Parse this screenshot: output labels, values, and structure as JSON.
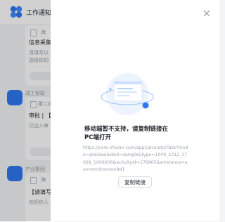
{
  "header": {
    "app_title": "工作通知:A"
  },
  "feed": {
    "card1": {
      "meta": "海",
      "title": "信息采集",
      "line1": "请填写以",
      "line2": "选择你的"
    },
    "card2": {
      "sender": "成工智联",
      "meta": "第二自动",
      "title": "审批 | 【",
      "line1": "已加入审"
    },
    "card3": {
      "sender": "产业集团",
      "meta": "海",
      "title": "【请填写",
      "line1": "欢迎你入"
    }
  },
  "modal": {
    "message": "移动端暂不支持，请复制链接在PC端打开",
    "url": "https://core.nfokan.com/appCalculatorTask?mode=preview&dsid=sample&type=1049_1012_17069_1006006&activityId=176805&wirstance=aonrmm0rxnnon9d1",
    "copy_label": "复制链接"
  },
  "colors": {
    "accent": "#2f78f0",
    "panel_bg": "#ffffff",
    "overlay": "rgba(0,0,0,0.18)"
  }
}
